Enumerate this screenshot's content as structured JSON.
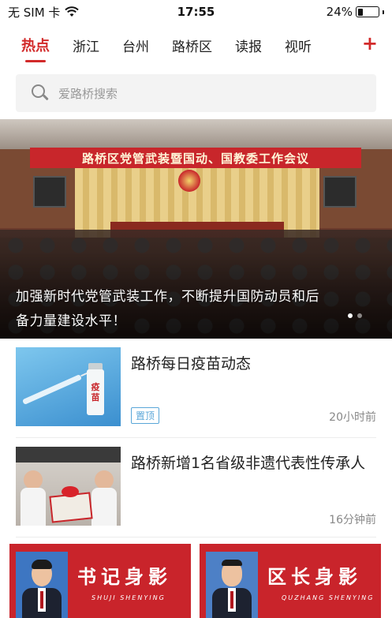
{
  "status_bar": {
    "carrier": "无 SIM 卡",
    "time": "17:55",
    "battery": "24%",
    "battery_level": 0.24
  },
  "tabs": [
    {
      "label": "热点",
      "active": true
    },
    {
      "label": "浙江",
      "active": false
    },
    {
      "label": "台州",
      "active": false
    },
    {
      "label": "路桥区",
      "active": false
    },
    {
      "label": "读报",
      "active": false
    },
    {
      "label": "视听",
      "active": false
    }
  ],
  "tab_add_icon": "plus-icon",
  "search": {
    "placeholder": "爱路桥搜索",
    "icon": "search-icon"
  },
  "hero": {
    "banner_text": "路桥区党管武装暨国动、国教委工作会议",
    "caption": "加强新时代党管武装工作，不断提升国防动员和后备力量建设水平！",
    "dots_count": 2,
    "active_dot": 0
  },
  "news": [
    {
      "title": "路桥每日疫苗动态",
      "badge": "置顶",
      "time": "20小时前",
      "thumb_label": "疫苗"
    },
    {
      "title": "路桥新增1名省级非遗代表性传承人",
      "badge": "",
      "time": "16分钟前"
    }
  ],
  "promos": [
    {
      "title": "书记身影",
      "subtitle": "SHUJI SHENYING"
    },
    {
      "title": "区长身影",
      "subtitle": "QUZHANG SHENYING"
    }
  ],
  "colors": {
    "accent": "#d22a2a",
    "badge": "#59a6d8",
    "promo_bg": "#c9242b"
  }
}
